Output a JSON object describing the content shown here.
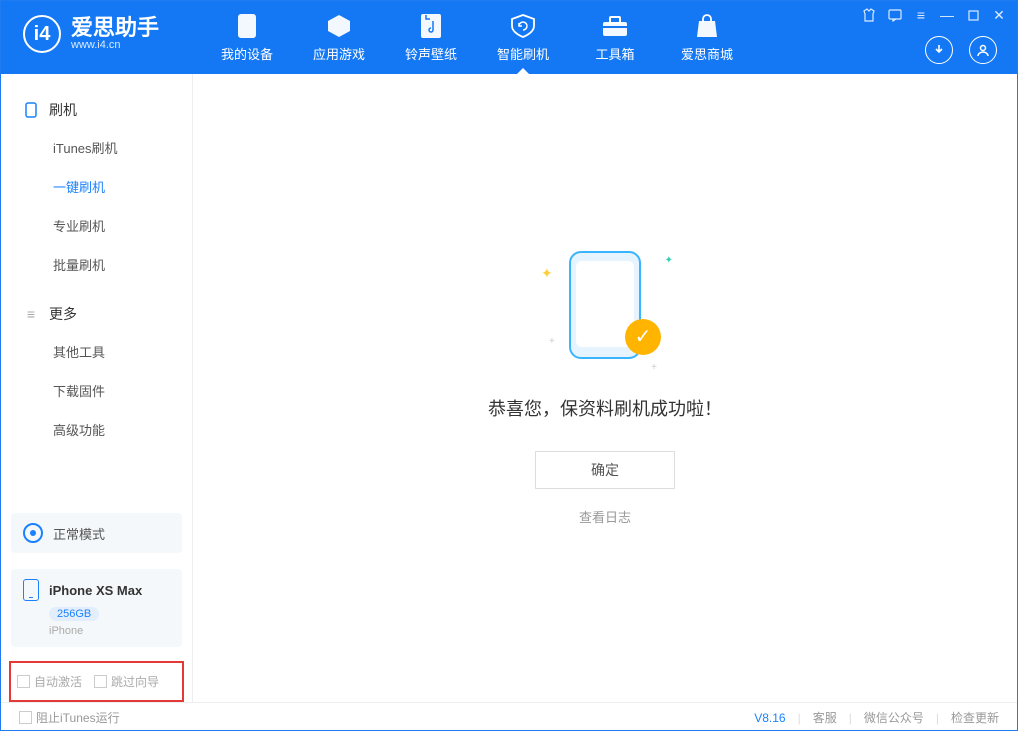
{
  "header": {
    "app_name": "爱思助手",
    "app_url": "www.i4.cn",
    "nav": [
      {
        "label": "我的设备"
      },
      {
        "label": "应用游戏"
      },
      {
        "label": "铃声壁纸"
      },
      {
        "label": "智能刷机"
      },
      {
        "label": "工具箱"
      },
      {
        "label": "爱思商城"
      }
    ]
  },
  "sidebar": {
    "group1_title": "刷机",
    "group1_items": [
      "iTunes刷机",
      "一键刷机",
      "专业刷机",
      "批量刷机"
    ],
    "group2_title": "更多",
    "group2_items": [
      "其他工具",
      "下载固件",
      "高级功能"
    ],
    "mode_label": "正常模式",
    "device_name": "iPhone XS Max",
    "device_capacity": "256GB",
    "device_type": "iPhone",
    "chk_auto_activate": "自动激活",
    "chk_skip_guide": "跳过向导"
  },
  "main": {
    "success_title": "恭喜您，保资料刷机成功啦！",
    "ok_button": "确定",
    "view_log": "查看日志"
  },
  "footer": {
    "block_itunes": "阻止iTunes运行",
    "version": "V8.16",
    "support": "客服",
    "wechat": "微信公众号",
    "check_update": "检查更新"
  }
}
